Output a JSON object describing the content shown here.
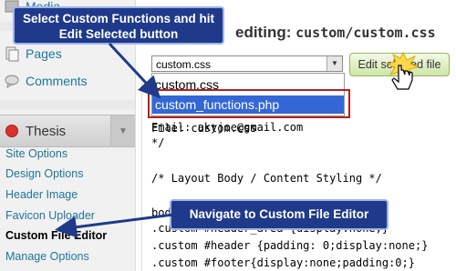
{
  "sidebar": {
    "media_label": "Media",
    "pages_label": "Pages",
    "comments_label": "Comments",
    "thesis_label": "Thesis",
    "sub_items": [
      {
        "label": "Site Options"
      },
      {
        "label": "Design Options"
      },
      {
        "label": "Header Image"
      },
      {
        "label": "Favicon Uploader"
      },
      {
        "label": "Custom File Editor"
      },
      {
        "label": "Manage Options"
      }
    ]
  },
  "editor": {
    "title_prefix": "editing:",
    "title_file": "custom/custom.css",
    "selected_file": "custom.css",
    "edit_button_label": "Edit selected file",
    "dropdown_options": [
      "custom.css",
      "custom_functions.php"
    ],
    "code_lines": [
      "File: custom.css",
      "Email: akyjoe@gmail.com",
      "*/",
      "",
      "/* Layout Body / Content Styling */",
      "",
      "body{",
      ".custom #header_area {display:none;}",
      ".custom #header {padding: 0;display:none;}",
      ".custom #footer{display:none;padding:0;}"
    ]
  },
  "callouts": {
    "top": "Select Custom Functions and hit Edit Selected button",
    "bottom": "Navigate to Custom File Editor"
  },
  "colors": {
    "callout_bg": "#1f3a8a",
    "link": "#21759b",
    "highlight_border": "#b22222",
    "selected_option_bg": "#3367d6",
    "edit_button_bg": "#cfe6a6"
  }
}
